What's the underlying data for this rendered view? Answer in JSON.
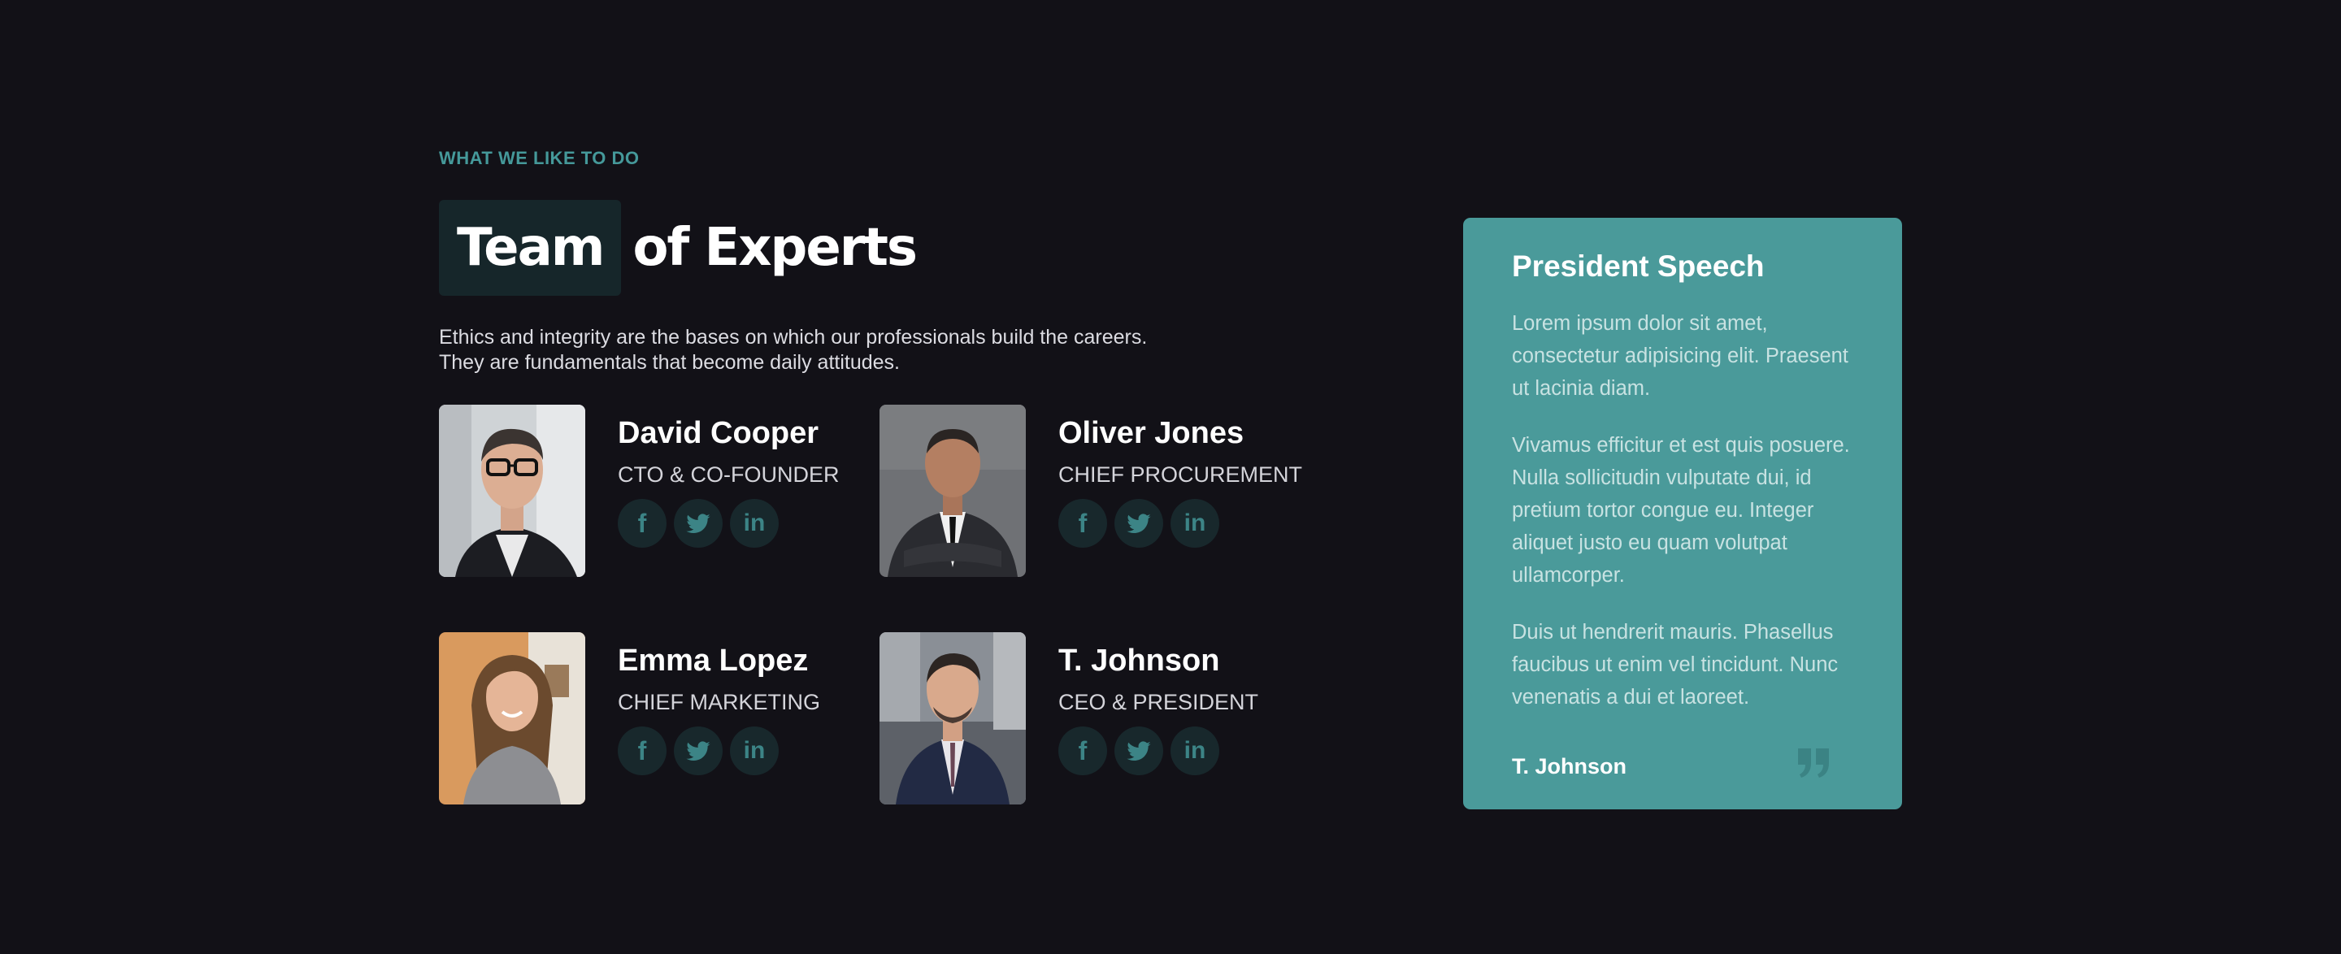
{
  "section": {
    "eyebrow": "WHAT WE LIKE TO DO",
    "title_highlight": "Team",
    "title_rest": "of Experts",
    "description_line1": "Ethics and integrity are the bases on which our professionals build the careers.",
    "description_line2": "They are fundamentals that become daily attitudes."
  },
  "team": [
    {
      "name": "David Cooper",
      "role": "CTO & CO-FOUNDER"
    },
    {
      "name": "Oliver Jones",
      "role": "CHIEF PROCUREMENT"
    },
    {
      "name": "Emma Lopez",
      "role": "CHIEF MARKETING"
    },
    {
      "name": "T. Johnson",
      "role": "CEO & PRESIDENT"
    }
  ],
  "social_icons": [
    "facebook-icon",
    "twitter-icon",
    "linkedin-icon"
  ],
  "speech": {
    "title": "President Speech",
    "paragraphs": [
      "Lorem ipsum dolor sit amet, consectetur adipisicing elit. Praesent ut lacinia diam.",
      "Vivamus efficitur et est quis posuere. Nulla sollicitudin vulputate dui, id pretium tortor congue eu. Integer aliquet justo eu quam volutpat ullamcorper.",
      "Duis ut hendrerit mauris. Phasellus faucibus ut enim vel tincidunt. Nunc venenatis a dui et laoreet."
    ],
    "author": "T. Johnson"
  },
  "colors": {
    "background": "#121117",
    "accent": "#45999a",
    "card": "#4a9a9a",
    "social_bg": "#18282c",
    "social_icon": "#3c8486"
  }
}
